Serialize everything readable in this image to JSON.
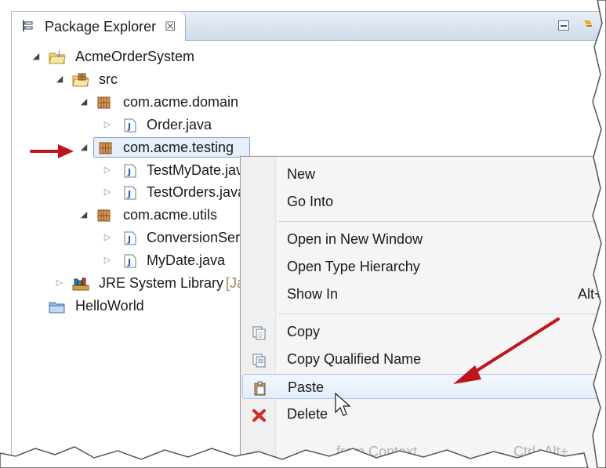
{
  "view": {
    "tab_label": "Package Explorer",
    "tab_close_glyph": "☒",
    "icons": {
      "tab": "package-explorer-icon",
      "close": "close-icon",
      "minimize": "minimize-icon",
      "view_menu": "view-menu-icon"
    }
  },
  "tree": {
    "items": [
      {
        "label": "AcmeOrderSystem",
        "icon": "java-project-icon",
        "expanded": true
      },
      {
        "label": "src",
        "icon": "source-folder-icon",
        "expanded": true
      },
      {
        "label": "com.acme.domain",
        "icon": "package-icon",
        "expanded": true
      },
      {
        "label": "Order.java",
        "icon": "java-file-icon",
        "expanded": false
      },
      {
        "label": "com.acme.testing",
        "icon": "package-icon",
        "expanded": true,
        "selected": true
      },
      {
        "label": "TestMyDate.jav",
        "icon": "java-file-icon",
        "expanded": false
      },
      {
        "label": "TestOrders.java",
        "icon": "java-file-icon",
        "expanded": false
      },
      {
        "label": "com.acme.utils",
        "icon": "package-icon",
        "expanded": true
      },
      {
        "label": "ConversionSer",
        "icon": "java-file-icon",
        "expanded": false
      },
      {
        "label": "MyDate.java",
        "icon": "java-file-icon",
        "expanded": false
      },
      {
        "label": "JRE System Library",
        "suffix": "[Ja",
        "icon": "library-icon",
        "expanded": false
      },
      {
        "label": "HelloWorld",
        "icon": "project-folder-icon",
        "expanded": false
      }
    ]
  },
  "context_menu": {
    "items": [
      {
        "label": "New"
      },
      {
        "label": "Go Into"
      },
      {
        "label": "Open in New Window"
      },
      {
        "label": "Open Type Hierarchy"
      },
      {
        "label": "Show In",
        "shortcut": "Alt+"
      },
      {
        "label": "Copy",
        "icon": "copy-icon"
      },
      {
        "label": "Copy Qualified Name",
        "icon": "copy-qualified-name-icon"
      },
      {
        "label": "Paste",
        "icon": "paste-icon",
        "highlighted": true
      },
      {
        "label": "Delete",
        "icon": "delete-icon"
      },
      {
        "label": "from Context",
        "shortcut": "Ctrl+Alt+",
        "faded": true
      }
    ]
  },
  "colors": {
    "annotation_arrow": "#c0141c",
    "selection_border": "#7da2ce",
    "menu_highlight_border": "#a8c8ee"
  }
}
